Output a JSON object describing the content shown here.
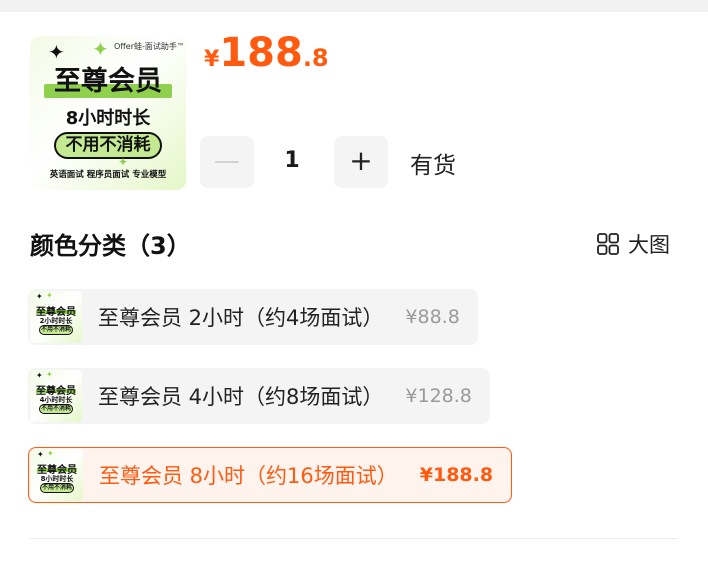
{
  "product": {
    "thumbnail": {
      "brand": "Offer蛙-面试助手™",
      "title": "至尊会员",
      "duration": "8小时时长",
      "pill": "不用不消耗",
      "footer": "英语面试 程序员面试 专业模型"
    },
    "price": {
      "currency": "¥",
      "integer": "188",
      "decimal": ".8"
    }
  },
  "quantity": {
    "minus_symbol": "—",
    "value": "1",
    "plus_symbol": "+"
  },
  "stock_status": "有货",
  "variants": {
    "title": "颜色分类（3）",
    "big_view_label": "大图",
    "options": [
      {
        "label": "至尊会员 2小时（约4场面试）",
        "price": "¥88.8",
        "thumb_duration": "2小时时长",
        "selected": false
      },
      {
        "label": "至尊会员 4小时（约8场面试）",
        "price": "¥128.8",
        "thumb_duration": "4小时时长",
        "selected": false
      },
      {
        "label": "至尊会员 8小时（约16场面试）",
        "price": "¥188.8",
        "thumb_duration": "8小时时长",
        "selected": true
      }
    ]
  },
  "icons": {
    "grid": "grid-view-icon",
    "sparkle": "sparkle-icon"
  },
  "colors": {
    "accent": "#ff5a0f",
    "brand_green": "#8fd14f",
    "muted_bg": "#f4f4f4"
  }
}
